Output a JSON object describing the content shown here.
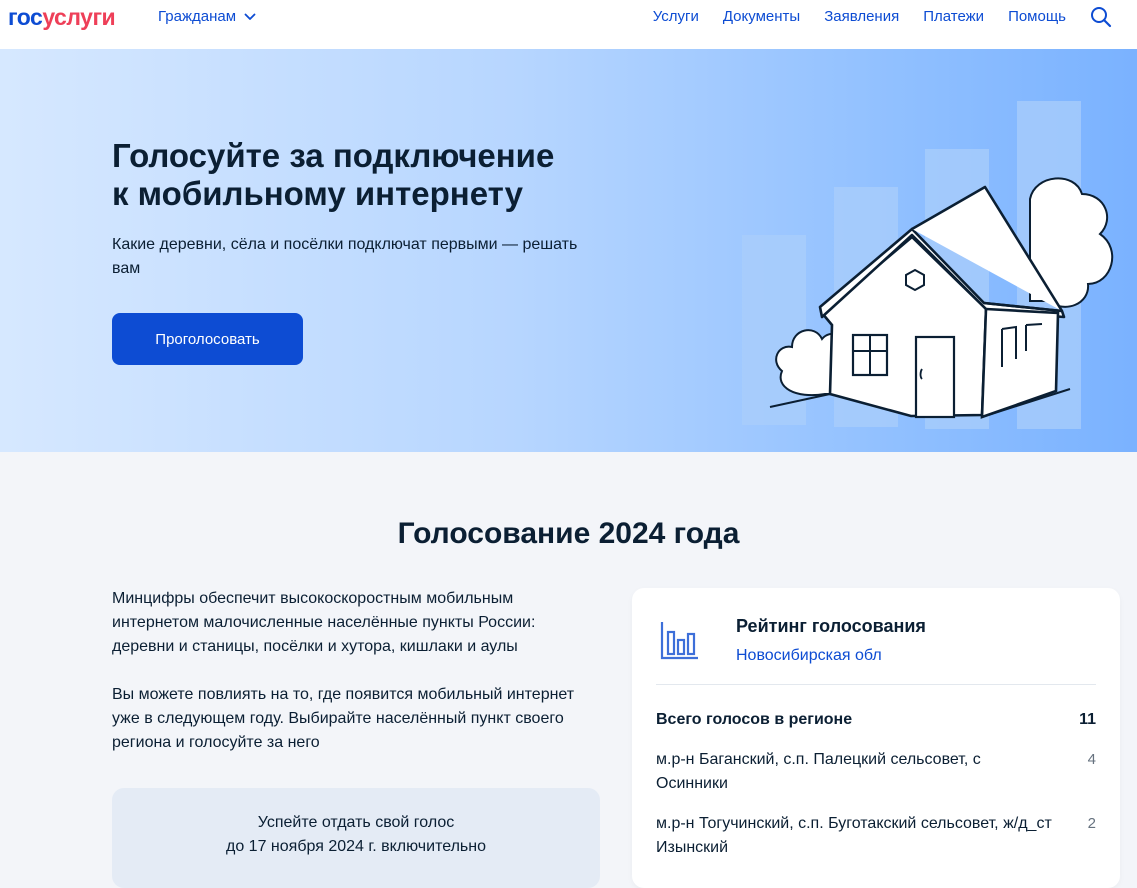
{
  "header": {
    "logo_part1": "гос",
    "logo_part2": "услуги",
    "citizens_menu": "Гражданам",
    "nav": [
      "Услуги",
      "Документы",
      "Заявления",
      "Платежи",
      "Помощь"
    ],
    "search_icon": "search-icon"
  },
  "hero": {
    "title_line1": "Голосуйте за подключение",
    "title_line2": "к мобильному интернету",
    "subtitle": "Какие деревни, сёла и посёлки подключат первыми — решать вам",
    "button": "Проголосовать"
  },
  "section": {
    "title": "Голосование 2024 года",
    "paragraph1": "Минцифры обеспечит высокоскоростным мобильным интернетом малочисленные населённые пункты России: деревни и станицы, посёлки и хутора, кишлаки и аулы",
    "paragraph2": "Вы можете повлиять на то, где появится мобильный интернет уже в следующем году. Выбирайте населённый пункт своего региона и голосуйте за него",
    "deadline_line1": "Успейте отдать свой голос",
    "deadline_line2": "до 17 ноября 2024 г. включительно"
  },
  "rating": {
    "title": "Рейтинг голосования",
    "region": "Новосибирская обл",
    "total_label": "Всего голосов в регионе",
    "total_value": "11",
    "items": [
      {
        "name": "м.р-н Баганский, с.п. Палецкий сельсовет, с Осинники",
        "votes": "4"
      },
      {
        "name": "м.р-н Тогучинский, с.п. Буготакский сельсовет, ж/д_ст Изынский",
        "votes": "2"
      }
    ]
  },
  "colors": {
    "accent": "#0d4cd3",
    "brand_red": "#ee3f58",
    "text": "#0b1f33",
    "page_bg": "#f3f5f9"
  }
}
